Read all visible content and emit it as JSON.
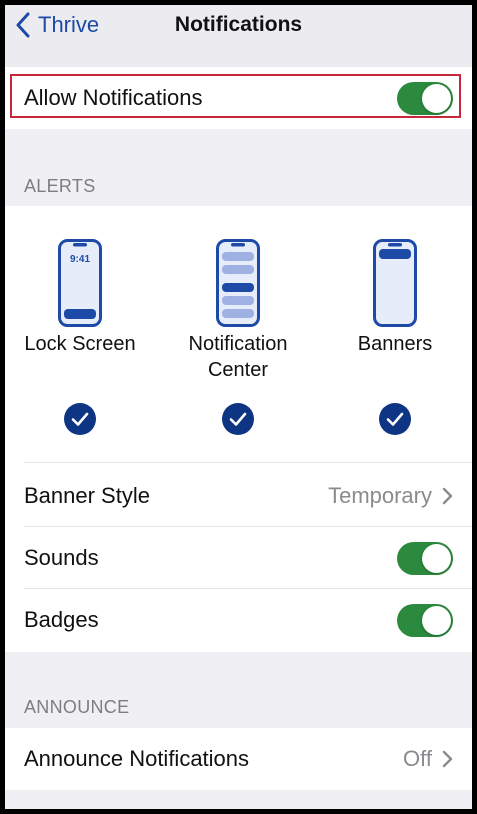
{
  "nav": {
    "back_label": "Thrive",
    "title": "Notifications"
  },
  "allow": {
    "label": "Allow Notifications",
    "enabled": true
  },
  "alerts": {
    "header": "ALERTS",
    "options": [
      {
        "label": "Lock Screen",
        "clock": "9:41",
        "selected": true
      },
      {
        "label": "Notification Center",
        "selected": true
      },
      {
        "label": "Banners",
        "selected": true
      }
    ],
    "banner_style": {
      "label": "Banner Style",
      "value": "Temporary"
    },
    "sounds": {
      "label": "Sounds",
      "enabled": true
    },
    "badges": {
      "label": "Badges",
      "enabled": true
    }
  },
  "announce": {
    "header": "ANNOUNCE",
    "row": {
      "label": "Announce Notifications",
      "value": "Off"
    }
  },
  "colors": {
    "accent": "#1c4aa6",
    "toggle_on": "#2b8a3e",
    "check_fill": "#0d3583",
    "highlight": "#c8283b"
  }
}
